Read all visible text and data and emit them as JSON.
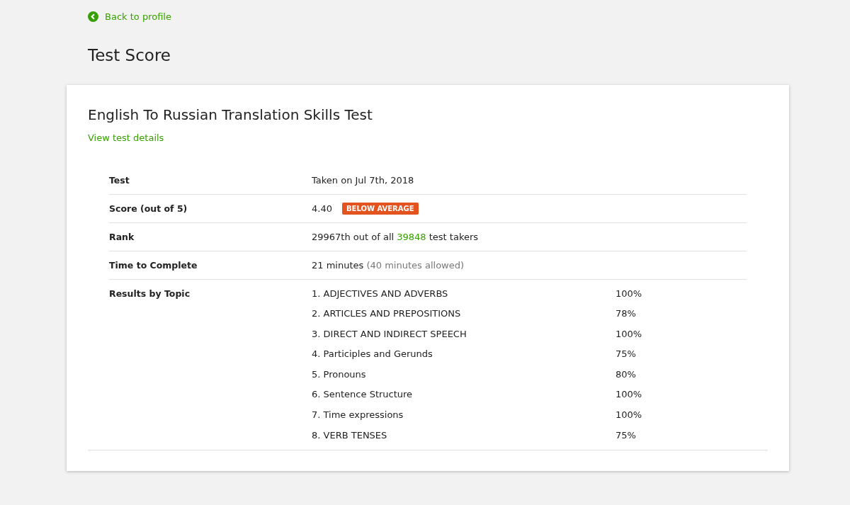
{
  "back_link": "Back to profile",
  "page_title": "Test Score",
  "card": {
    "title": "English To Russian Translation Skills Test",
    "details_link": "View test details",
    "rows": [
      {
        "kind": "text",
        "label": "Test",
        "value": "Taken on Jul 7th, 2018"
      },
      {
        "kind": "score",
        "label": "Score (out of 5)",
        "value": "4.40",
        "badge": "BELOW AVERAGE"
      },
      {
        "kind": "rank",
        "label": "Rank",
        "prefix": "29967th out of all",
        "total": "39848",
        "suffix": "test takers"
      },
      {
        "kind": "time",
        "label": "Time to Complete",
        "value": "21 minutes",
        "allowed": "(40 minutes allowed)"
      },
      {
        "kind": "topics",
        "label": "Results by Topic",
        "topics": [
          {
            "name": "1. ADJECTIVES AND ADVERBS",
            "percent": "100%"
          },
          {
            "name": "2. ARTICLES AND PREPOSITIONS",
            "percent": "78%"
          },
          {
            "name": "3. DIRECT AND INDIRECT SPEECH",
            "percent": "100%"
          },
          {
            "name": "4. Participles and Gerunds",
            "percent": "75%"
          },
          {
            "name": "5. Pronouns",
            "percent": "80%"
          },
          {
            "name": "6. Sentence Structure",
            "percent": "100%"
          },
          {
            "name": "7. Time expressions",
            "percent": "100%"
          },
          {
            "name": "8. VERB TENSES",
            "percent": "75%"
          }
        ]
      }
    ]
  }
}
